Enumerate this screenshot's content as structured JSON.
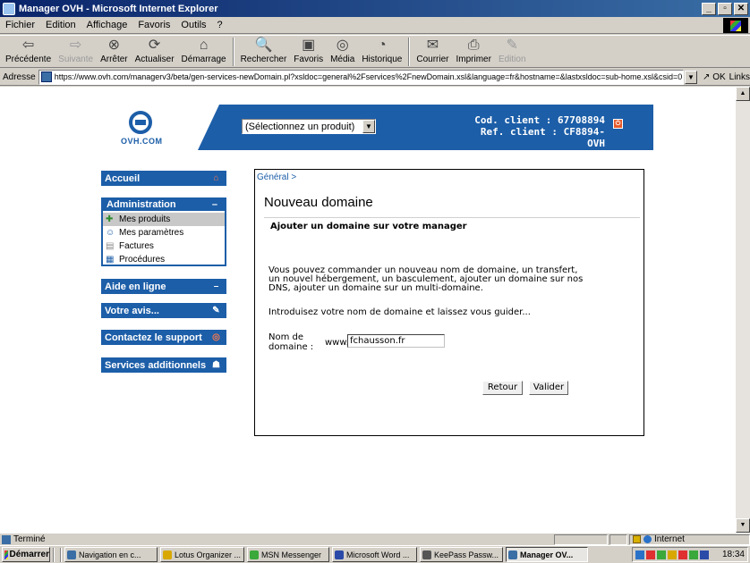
{
  "window": {
    "title": "Manager OVH - Microsoft Internet Explorer",
    "min": "_",
    "max": "▫",
    "close": "✕"
  },
  "menu": [
    "Fichier",
    "Edition",
    "Affichage",
    "Favoris",
    "Outils",
    "?"
  ],
  "toolbar": {
    "back": "Précédente",
    "forward": "Suivante",
    "stop": "Arrêter",
    "refresh": "Actualiser",
    "home": "Démarrage",
    "search": "Rechercher",
    "favorites": "Favoris",
    "media": "Média",
    "history": "Historique",
    "mail": "Courrier",
    "print": "Imprimer",
    "edit": "Edition"
  },
  "address": {
    "label": "Adresse",
    "url": "https://www.ovh.com/managerv3/beta/gen-services-newDomain.pl?xsldoc=general%2Fservices%2FnewDomain.xsl&language=fr&hostname=&lastxsldoc=sub-home.xsl&csid=0",
    "go": "OK",
    "links": "Links"
  },
  "banner": {
    "logo_text": "OVH.COM",
    "product_select": "(Sélectionnez un produit)",
    "client_code": "Cod. client : 67708894",
    "client_ref": "Ref. client : CF8894-OVH"
  },
  "nav": {
    "accueil": "Accueil",
    "administration": "Administration",
    "admin_items": [
      "Mes produits",
      "Mes paramètres",
      "Factures",
      "Procédures"
    ],
    "aide": "Aide en ligne",
    "avis": "Votre avis...",
    "support": "Contactez le support",
    "services": "Services additionnels"
  },
  "content": {
    "breadcrumb": "Général >",
    "title": "Nouveau domaine",
    "section": "Ajouter un domaine sur votre manager",
    "intro_1": "Vous pouvez commander un nouveau nom de domaine, un transfert,",
    "intro_2": "un nouvel hébergement, un basculement, ajouter un domaine sur nos",
    "intro_3": "DNS, ajouter un domaine sur un multi-domaine.",
    "guide": "Introduisez votre nom de domaine et laissez vous guider...",
    "domain_label_1": "Nom de",
    "domain_label_2": "domaine :",
    "www": "www.",
    "domain_value": "fchausson.fr",
    "back_button": "Retour",
    "submit_button": "Valider"
  },
  "status": {
    "text": "Terminé",
    "zone": "Internet"
  },
  "taskbar": {
    "start": "Démarrer",
    "tasks": [
      "Navigation en c...",
      "Lotus Organizer ...",
      "MSN Messenger",
      "Microsoft Word ...",
      "KeePass Passw...",
      "Manager OV..."
    ],
    "clock": "18:34"
  }
}
